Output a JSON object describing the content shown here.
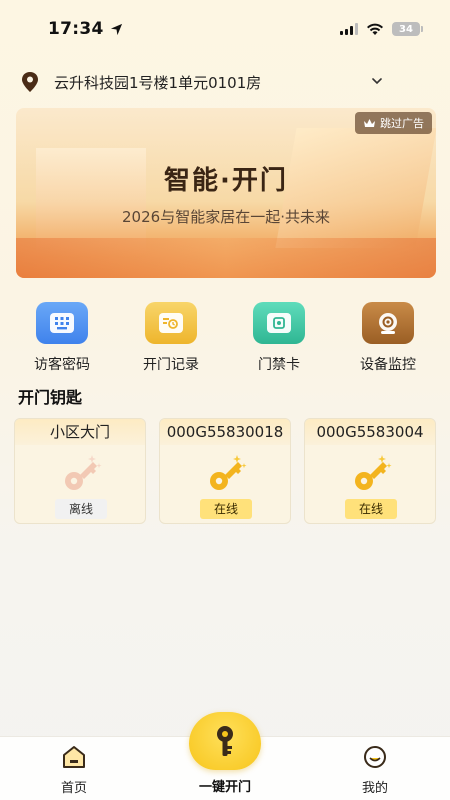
{
  "status": {
    "time": "17:34",
    "battery": "34"
  },
  "address": {
    "text": "云升科技园1号楼1单元0101房"
  },
  "banner": {
    "title": "智能·开门",
    "subtitle": "2026与智能家居在一起·共未来",
    "skip_label": "跳过广告"
  },
  "actions": [
    {
      "label": "访客密码",
      "color": "#4a8ff0"
    },
    {
      "label": "开门记录",
      "color": "#f0c040"
    },
    {
      "label": "门禁卡",
      "color": "#3fc7a6"
    },
    {
      "label": "设备监控",
      "color": "#b8732c"
    }
  ],
  "keys_section": {
    "title": "开门钥匙"
  },
  "keys": [
    {
      "name": "小区大门",
      "status": "离线"
    },
    {
      "name": "000G55830018",
      "status": "在线"
    },
    {
      "name": "000G5583004",
      "status": "在线"
    }
  ],
  "tabbar": {
    "home": "首页",
    "unlock": "一键开门",
    "mine": "我的"
  }
}
